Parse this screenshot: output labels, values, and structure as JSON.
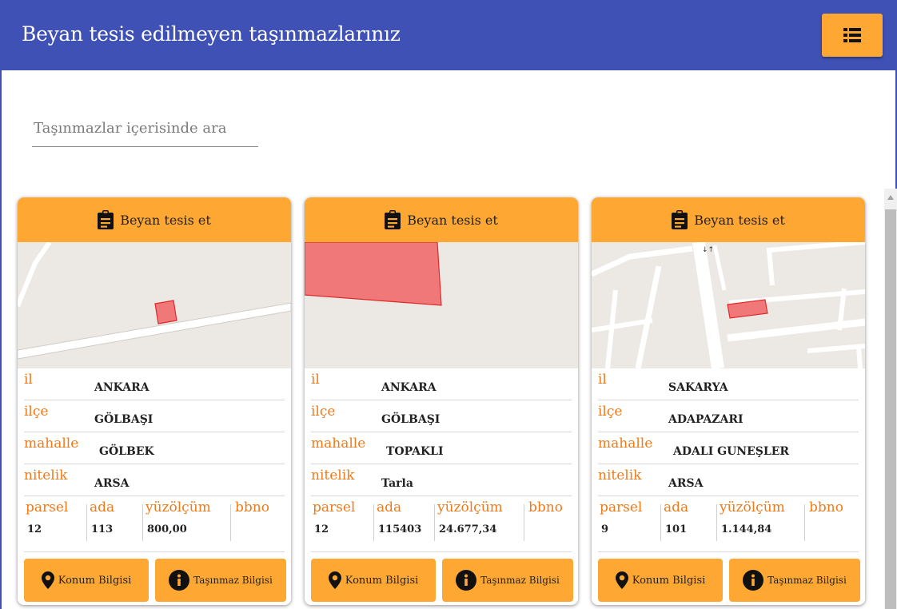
{
  "header": {
    "title": "Beyan tesis edilmeyen taşınmazlarınız",
    "menu_icon": "list-icon",
    "accent_color": "#3f51b5",
    "button_color": "#ffa733"
  },
  "search": {
    "placeholder": "Taşınmazlar içerisinde ara",
    "value": ""
  },
  "labels": {
    "declare": "Beyan tesis et",
    "il": "il",
    "ilce": "ilçe",
    "mahalle": "mahalle",
    "nitelik": "nitelik",
    "parsel": "parsel",
    "ada": "ada",
    "yuzolcum": "yüzölçüm",
    "bbno": "bbno",
    "konum": "Konum Bilgisi",
    "tasinmaz": "Taşınmaz Bilgisi"
  },
  "cards": [
    {
      "il": "ANKARA",
      "ilce": "GÖLBAŞI",
      "mahalle": "GÖLBEK",
      "nitelik": "ARSA",
      "parsel": "12",
      "ada": "113",
      "yuzolcum": "800,00",
      "bbno": ""
    },
    {
      "il": "ANKARA",
      "ilce": "GÖLBAŞI",
      "mahalle": "TOPAKLI",
      "nitelik": "Tarla",
      "parsel": "12",
      "ada": "115403",
      "yuzolcum": "24.677,34",
      "bbno": ""
    },
    {
      "il": "SAKARYA",
      "ilce": "ADAPAZARI",
      "mahalle": "ADALI GUNEŞLER",
      "nitelik": "ARSA",
      "parsel": "9",
      "ada": "101",
      "yuzolcum": "1.144,84",
      "bbno": ""
    }
  ]
}
